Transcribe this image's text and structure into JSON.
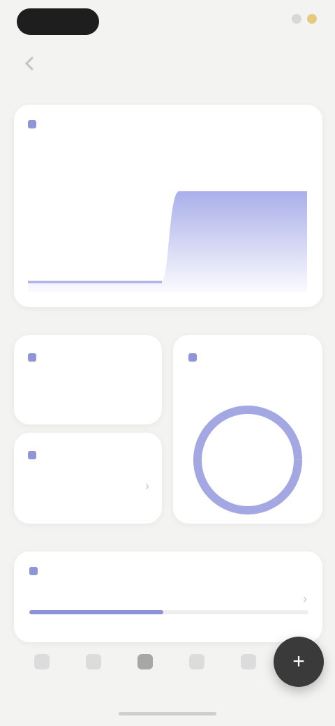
{
  "status_bar": {
    "time": "",
    "indicators": [
      "signal-icon",
      "battery-icon"
    ]
  },
  "header": {
    "title": "",
    "action": ""
  },
  "chart_card": {
    "label": "",
    "range": "",
    "value": "",
    "accent": "#8f96d8"
  },
  "stat_cards": [
    {
      "label": "",
      "value": ""
    },
    {
      "label": "",
      "value": ""
    }
  ],
  "ring_card": {
    "label": "",
    "value": "",
    "accent": "#9aa0e0"
  },
  "activity_card": {
    "title": "",
    "row_label": "",
    "row_sub": "",
    "progress": 0.48
  },
  "tab_bar": {
    "tabs": [
      {
        "label": "",
        "icon": "home-icon"
      },
      {
        "label": "",
        "icon": "chart-icon"
      },
      {
        "label": "",
        "icon": "grid-icon"
      },
      {
        "label": "",
        "icon": "calendar-icon"
      },
      {
        "label": "",
        "icon": "user-icon"
      }
    ],
    "active_index": 2,
    "fab_icon": "plus-icon"
  }
}
